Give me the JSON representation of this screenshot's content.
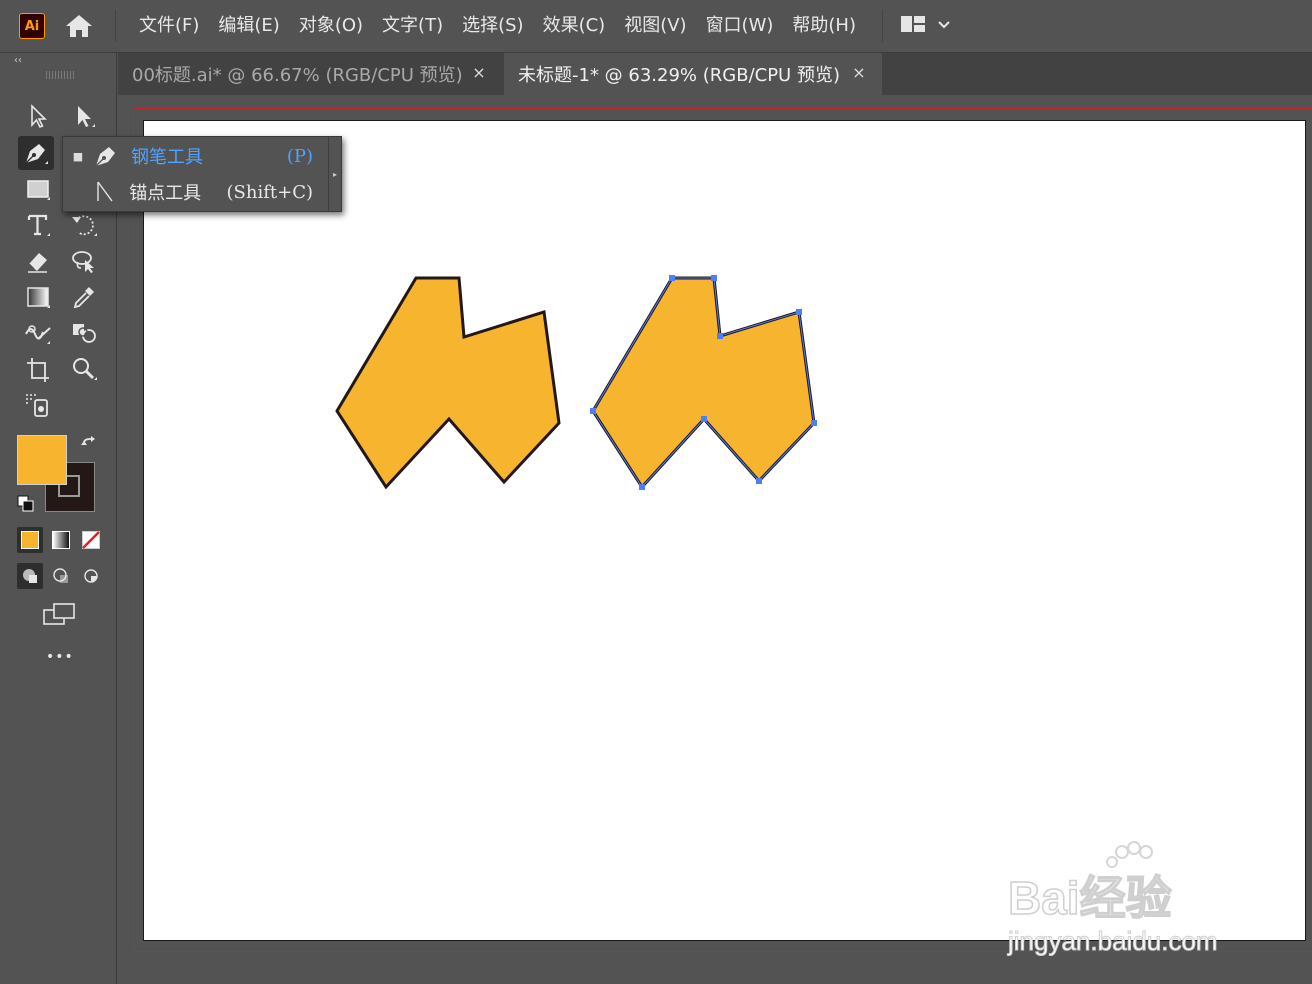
{
  "app": {
    "logo_text": "Ai",
    "accent": "#ff9a00"
  },
  "menu": {
    "items": [
      "文件(F)",
      "编辑(E)",
      "对象(O)",
      "文字(T)",
      "选择(S)",
      "效果(C)",
      "视图(V)",
      "窗口(W)",
      "帮助(H)"
    ]
  },
  "tabs": [
    {
      "label": "00标题.ai* @ 66.67% (RGB/CPU 预览)",
      "close": "×",
      "active": false
    },
    {
      "label": "未标题-1* @ 63.29% (RGB/CPU 预览)",
      "close": "×",
      "active": true
    }
  ],
  "flyout": {
    "items": [
      {
        "label": "钢笔工具",
        "shortcut": "(P)",
        "selected": true,
        "bullet": "■"
      },
      {
        "label": "锚点工具",
        "shortcut": "(Shift+C)",
        "selected": false,
        "bullet": ""
      }
    ]
  },
  "colors": {
    "fill": "#f7b52f",
    "stroke": "#231815",
    "selection": "#4f7df5",
    "bleed": "#c0282d",
    "flyout_selected_text": "#4fa3ff"
  },
  "toolbar": {
    "tools": [
      "direct-selection",
      "selection",
      "pen",
      "rectangle",
      "type",
      "rotate",
      "eraser",
      "lasso",
      "gradient",
      "eyedropper",
      "blend",
      "shape-builder",
      "artboard",
      "zoom",
      "symbol-sprayer"
    ],
    "more": "•••"
  },
  "watermark": {
    "brand": "Bai经验",
    "url": "jingyan.baidu.com"
  }
}
